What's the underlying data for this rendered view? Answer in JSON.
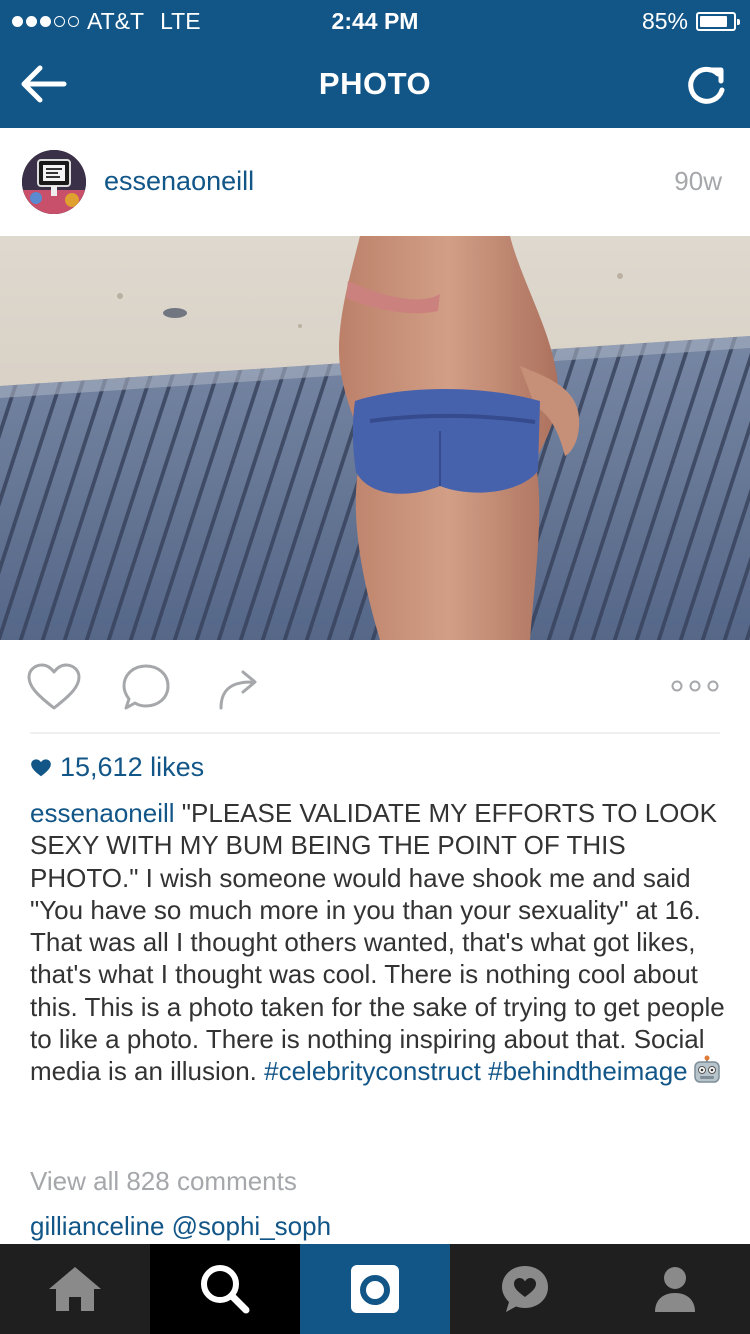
{
  "status_bar": {
    "carrier": "AT&T",
    "network": "LTE",
    "time": "2:44 PM",
    "battery": "85%",
    "battery_level": 0.85,
    "signal_bars_filled": 3,
    "signal_bars_total": 5
  },
  "nav": {
    "title": "PHOTO",
    "back_icon": "back-arrow-icon",
    "refresh_icon": "refresh-icon"
  },
  "post": {
    "username": "essenaoneill",
    "time_ago": "90w",
    "likes": "15,612 likes",
    "caption": {
      "username": "essenaoneill",
      "text": " \"PLEASE VALIDATE MY EFFORTS TO LOOK SEXY WITH MY BUM BEING THE POINT OF THIS PHOTO.\" I wish someone would have shook me and said \"You have so much more in you than your sexuality\" at 16. That was all I thought others wanted, that's what got likes, that's what I thought was cool. There is nothing cool about this. This is a photo taken for the sake of trying to get people to like a photo. There is nothing inspiring about that. Social media is an illusion. ",
      "hashtag_1": "#celebrityconstruct",
      "hashtag_2": "#behindtheimage",
      "emoji": "robot-face"
    },
    "view_all_comments": "View all 828 comments",
    "first_comment": {
      "username": "gillianceline",
      "text": "@sophi_soph"
    }
  },
  "colors": {
    "brand_blue": "#125688",
    "muted_gray": "#a5a7aa",
    "tabbar_bg": "#1f1f1f"
  },
  "tabs": [
    {
      "name": "home",
      "icon": "home-icon"
    },
    {
      "name": "search",
      "icon": "search-icon"
    },
    {
      "name": "camera",
      "icon": "camera-icon",
      "active": true
    },
    {
      "name": "activity",
      "icon": "activity-icon"
    },
    {
      "name": "profile",
      "icon": "profile-icon"
    }
  ]
}
